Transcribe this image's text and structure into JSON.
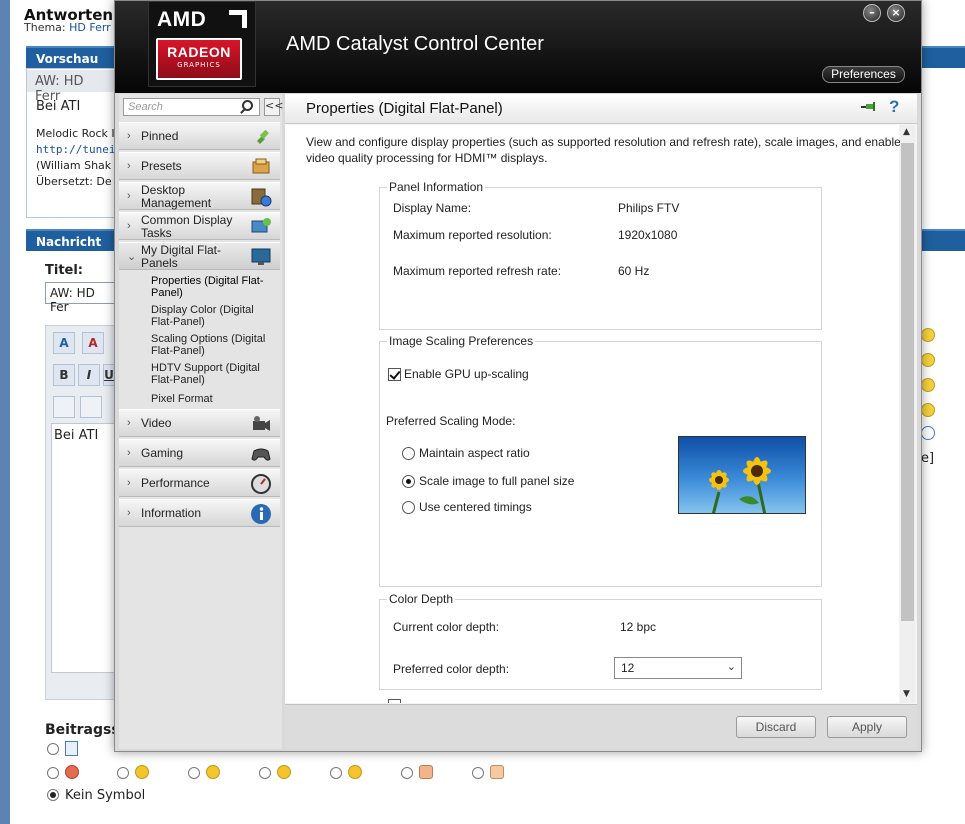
{
  "background_page": {
    "title": "Antworten",
    "thema_label": "Thema:",
    "thema_link": "HD Ferr",
    "vorschau_header": "Vorschau",
    "preview_subject": "AW: HD Ferr",
    "preview_body": "Bei ATI",
    "sig_line1": "Melodic Rock I",
    "sig_line2": "http://tunein.c",
    "sig_line3": "(William Shak",
    "sig_line4": "Übersetzt: De",
    "nachricht_header": "Nachricht",
    "titel_label": "Titel:",
    "titel_value": "AW: HD Fer",
    "toolbar": {
      "b": "B",
      "i": "I",
      "u": "U"
    },
    "message_text": "Bei ATI",
    "beitrag_label": "Beitragss",
    "kein_symbol": "Kein Symbol",
    "right_text": "e]"
  },
  "window": {
    "logo_amd": "AMD",
    "logo_radeon": "RADEON",
    "logo_graphics": "GRAPHICS",
    "title": "AMD Catalyst Control Center",
    "preferences_label": "Preferences",
    "minimize_symbol": "–",
    "close_symbol": "×"
  },
  "sidebar": {
    "search_placeholder": "Search",
    "collapse_symbol": "<<",
    "items": [
      {
        "label": "Pinned",
        "icon": "pin-icon"
      },
      {
        "label": "Presets",
        "icon": "presets-icon"
      },
      {
        "label": "Desktop Management",
        "icon": "desktop-management-icon"
      },
      {
        "label": "Common Display Tasks",
        "icon": "display-tasks-icon"
      },
      {
        "label": "My Digital Flat-Panels",
        "icon": "monitor-icon"
      },
      {
        "label": "Video",
        "icon": "video-camera-icon"
      },
      {
        "label": "Gaming",
        "icon": "gamepad-icon"
      },
      {
        "label": "Performance",
        "icon": "gauge-icon"
      },
      {
        "label": "Information",
        "icon": "info-icon"
      }
    ],
    "sub_items": [
      "Properties (Digital Flat-Panel)",
      "Display Color (Digital Flat-Panel)",
      "Scaling Options (Digital Flat-Panel)",
      "HDTV Support (Digital Flat-Panel)",
      "Pixel Format"
    ]
  },
  "main": {
    "title": "Properties (Digital Flat-Panel)",
    "help_symbol": "?",
    "intro": "View and configure display properties (such as supported resolution and refresh rate), scale images, and enable video quality processing for HDMI™ displays.",
    "panel_info": {
      "legend": "Panel Information",
      "display_name_label": "Display Name:",
      "display_name_value": "Philips FTV",
      "max_res_label": "Maximum reported resolution:",
      "max_res_value": "1920x1080",
      "max_refresh_label": "Maximum reported refresh rate:",
      "max_refresh_value": "60 Hz"
    },
    "scaling": {
      "legend": "Image Scaling Preferences",
      "gpu_upscaling_label": "Enable GPU up-scaling",
      "gpu_upscaling_checked": true,
      "mode_label": "Preferred Scaling Mode:",
      "options": [
        "Maintain aspect ratio",
        "Scale image to full panel size",
        "Use centered timings"
      ],
      "selected_option": 1
    },
    "color_depth": {
      "legend": "Color Depth",
      "current_label": "Current color depth:",
      "current_value": "12 bpc",
      "preferred_label": "Preferred color depth:",
      "preferred_value": "12"
    },
    "discard_label": "Discard",
    "apply_label": "Apply"
  }
}
